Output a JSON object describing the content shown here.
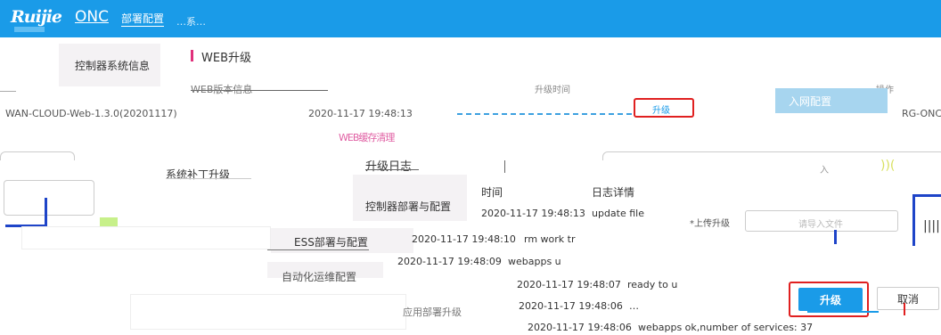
{
  "header": {
    "logo": "Ruijie",
    "app_name": "ONC",
    "page_title": "部署配置",
    "ghost_text": "…系…"
  },
  "sidebar": {
    "active_item": "控制器系统信息",
    "items": [
      {
        "label": "控制器部署与配置"
      },
      {
        "label": "ESS部署与配置"
      },
      {
        "label": "自动化运维配置"
      },
      {
        "label": "应用部署升级"
      }
    ]
  },
  "section": {
    "title": "WEB升级"
  },
  "version_table": {
    "col_version": "WEB版本信息",
    "col_time": "升级时间",
    "col_op": "操作",
    "row_version": "WAN-CLOUD-Web-1.3.0(20201117)",
    "row_time": "2020-11-17 19:48:13",
    "row_device": "RG-ONC",
    "upgrade_link": "升级"
  },
  "menus": {
    "net_config": "入网配置",
    "web_cache": "WEB缓存清理"
  },
  "patch": {
    "label": "系统补丁升级",
    "mark": "入",
    "mark2": "))("
  },
  "upload": {
    "label": "*上传升级",
    "placeholder": "请导入文件",
    "bars": "|||||"
  },
  "log_dialog": {
    "title": "升级日志",
    "col_time": "时间",
    "col_detail": "日志详情",
    "rows": [
      {
        "time": "2020-11-17 19:48:13",
        "detail": "update file"
      },
      {
        "time": "2020-11-17 19:48:10",
        "detail": "rm work tr"
      },
      {
        "time": "2020-11-17 19:48:09",
        "detail": "webapps u"
      },
      {
        "time": "2020-11-17 19:48:07",
        "detail": "ready to u"
      },
      {
        "time": "2020-11-17 19:48:06",
        "detail": "…"
      },
      {
        "time": "2020-11-17 19:48:06",
        "detail": "webapps ok,number of services: 37"
      }
    ]
  },
  "buttons": {
    "upgrade": "升级",
    "cancel": "取消"
  },
  "colors": {
    "header_blue": "#1a9be8",
    "highlight_red": "#e02020",
    "section_pink": "#e0317b",
    "tooltip_blue": "#a7d5ef"
  }
}
